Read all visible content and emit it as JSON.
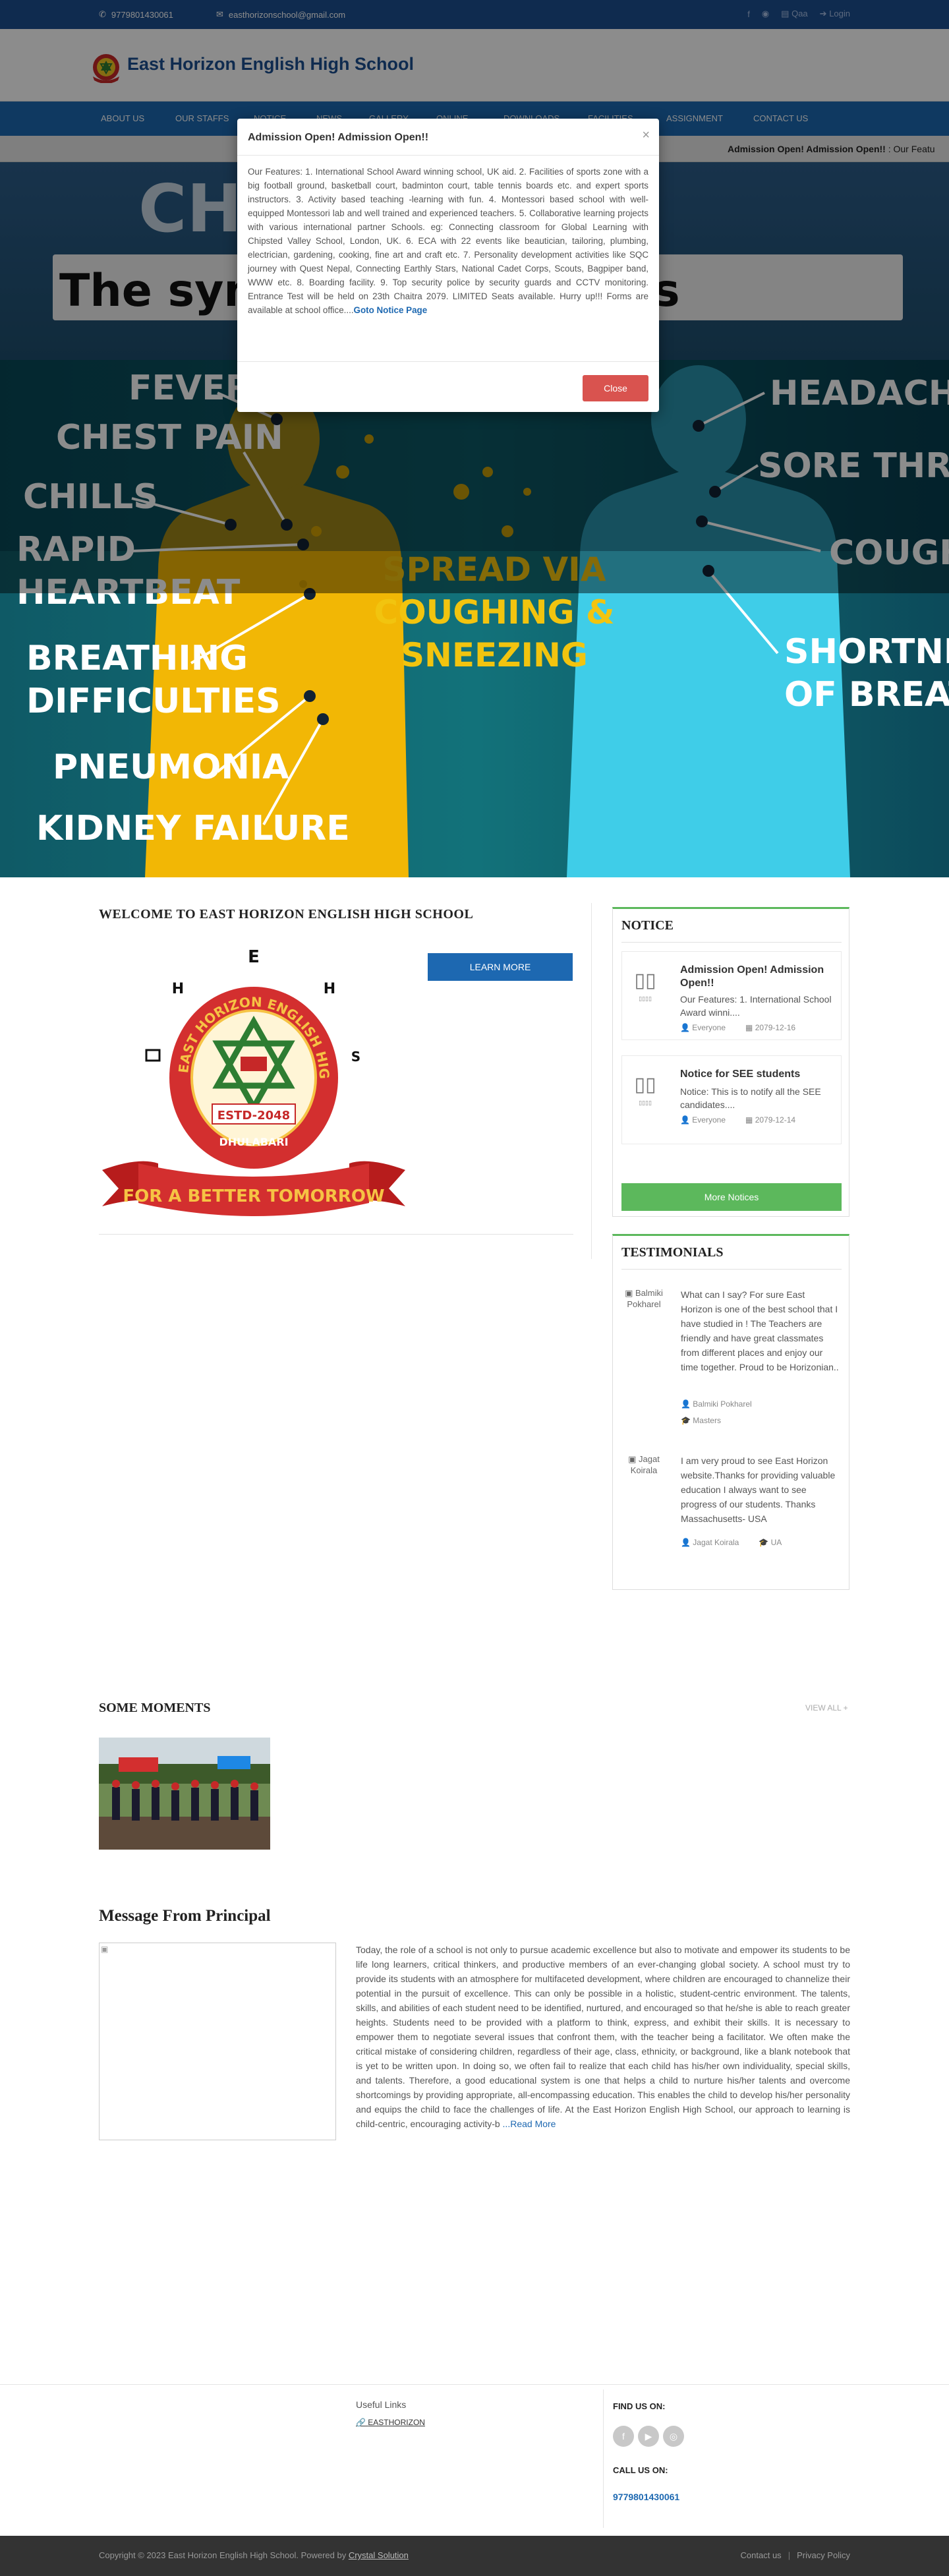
{
  "topbar": {
    "phone": "9779801430061",
    "email": "easthorizonschool@gmail.com",
    "qaa": "Qaa",
    "login": "Login"
  },
  "header": {
    "site_title": "East Horizon English High School"
  },
  "nav": {
    "items": [
      "ABOUT US",
      "OUR STAFFS",
      "NOTICE",
      "NEWS",
      "GALLERY",
      "ONLINE",
      "DOWNLOADS",
      "FACILITIES",
      "ASSIGNMENT",
      "CONTACT US"
    ]
  },
  "ticker": {
    "bold": "Admission Open! Admission Open!!",
    "rest": " : Our Featu"
  },
  "banner": {
    "title_top": "CH  RUS",
    "symptom_line": "The sympt                          ow it spreads",
    "labels_left": [
      "FEVER",
      "CHEST PAIN",
      "CHILLS",
      "RAPID",
      "HEARTBEAT",
      "BREATHING",
      "DIFFICULTIES",
      "PNEUMONIA",
      "KIDNEY FAILURE"
    ],
    "labels_right": [
      "HEADACHE",
      "SORE THROAT",
      "COUGH",
      "SHORTNESS",
      "OF BREATH"
    ],
    "spread": [
      "SPREAD VIA",
      "COUGHING &",
      "SNEEZING"
    ]
  },
  "modal": {
    "title": "Admission Open! Admission Open!!",
    "close": "×",
    "body": "Our Features: 1. International School Award winning school, UK aid. 2. Facilities of sports zone with a big football ground, basketball court, badminton court, table tennis boards etc. and expert sports instructors. 3. Activity based teaching -learning with fun. 4. Montessori based school with well- equipped Montessori lab and well trained and experienced teachers. 5. Collaborative learning projects with various international partner Schools. eg: Connecting classroom for Global Learning with Chipsted Valley School, London, UK. 6. ECA with 22 events like beautician, tailoring, plumbing, electrician, gardening, cooking, fine art and craft etc. 7. Personality development activities like SQC journey with Quest Nepal, Connecting Earthly Stars, National Cadet Corps, Scouts, Bagpiper band, WWW etc. 8. Boarding facility. 9. Top security police by security guards and CCTV monitoring. Entrance Test will be held on 23th Chaitra 2079. LIMITED Seats available. Hurry up!!! Forms are available at school office....",
    "link": "Goto Notice Page",
    "button": "Close"
  },
  "welcome": {
    "title": "WELCOME TO EAST HORIZON ENGLISH HIGH SCHOOL",
    "learn_more": "LEARN MORE",
    "logo": {
      "ring": "EAST HORIZON ENGLISH HIGH SCHOOL",
      "estd": "ESTD-2048",
      "place": "DHULABARI",
      "motto": "FOR A BETTER TOMORROW",
      "letters": [
        "E",
        "H",
        "H",
        "S"
      ]
    }
  },
  "notice": {
    "title": "NOTICE",
    "items": [
      {
        "title": "Admission Open! Admission Open!!",
        "excerpt": "Our Features: 1. International School Award winni....",
        "audience": "Everyone",
        "date": "2079-12-16"
      },
      {
        "title": "Notice for SEE students",
        "excerpt": "Notice: This is to notify all the SEE candidates....",
        "audience": "Everyone",
        "date": "2079-12-14"
      }
    ],
    "more": "More Notices"
  },
  "testimonials": {
    "title": "TESTIMONIALS",
    "items": [
      {
        "avatar_alt": "Balmiki Pokharel",
        "quote": "What can I say? For sure East Horizon is one of the best school that I have studied in ! The Teachers are friendly and have great classmates from different places and enjoy our time together. Proud to be Horizonian..",
        "name": "Balmiki Pokharel",
        "degree": "Masters"
      },
      {
        "avatar_alt": "Jagat Koirala",
        "quote": "I am very proud to see East Horizon website.Thanks for providing valuable education I always want to see progress of our students. Thanks Massachusetts- USA",
        "name": "Jagat Koirala",
        "degree": "UA"
      }
    ]
  },
  "moments": {
    "title": "SOME MOMENTS",
    "view_all": "VIEW ALL +"
  },
  "principal": {
    "title": "Message From Principal",
    "text": "Today, the role of a school is not only to pursue academic excellence but also to motivate and empower its students to be life long learners, critical thinkers, and productive members of an ever-changing global society. A school must try to provide its students with an atmosphere for multifaceted development, where children are encouraged to channelize their potential in the pursuit of excellence. This can only be possible in a holistic, student-centric environment. The talents, skills, and abilities of each student need to be identified, nurtured, and encouraged so that he/she is able to reach greater heights. Students need to be provided with a platform to think, express, and exhibit their skills. It is necessary to empower them to negotiate several issues that confront them, with the teacher being a facilitator. We often make the critical mistake of considering children, regardless of their age, class, ethnicity, or background, like a blank notebook that is yet to be written upon. In doing so, we often fail to realize that each child has his/her own individuality, special skills, and talents. Therefore, a good educational system is one that helps a child to nurture his/her talents and overcome shortcomings by providing appropriate, all-encompassing education. This enables the child to develop his/her personality and equips the child to face the challenges of life. At the East Horizon English High School, our approach to learning is child-centric, encouraging activity-b",
    "read_more": "...Read More"
  },
  "footer": {
    "useful_links": "Useful Links",
    "link1": "EASTHORIZON",
    "find_us": "FIND US ON:",
    "call_us": "CALL US ON:",
    "phone": "9779801430061",
    "copyright": "Copyright © 2023 East Horizon English High School. Powered by ",
    "powered": "Crystal Solution",
    "contact": "Contact us",
    "privacy": "Privacy Policy"
  },
  "colors": {
    "topbar": "#1d4f90",
    "nav": "#1d68b1",
    "accent_green": "#5cb85c",
    "danger": "#d9534f"
  }
}
